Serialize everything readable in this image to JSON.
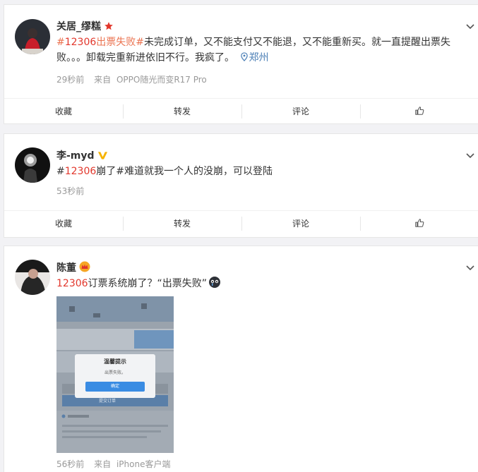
{
  "posts": [
    {
      "author": "关居_缪糕",
      "badge": "red-star-icon",
      "text": {
        "hash_open": "#",
        "num": "12306",
        "topic_rest": "出票失败#",
        "rest": "未完成订单，又不能支付又不能退，又不能重新买。就一直提醒出票失败。。。卸载完重新进依旧不行。我疯了。",
        "location": "郑州"
      },
      "time": "29秒前",
      "source_prefix": "来自",
      "source": "OPPO随光而变R17 Pro"
    },
    {
      "author": "李-myd",
      "badge": "verified-v-icon",
      "text": {
        "hash_open": "#",
        "num": "12306",
        "topic_rest": "崩了#",
        "rest": "难道就我一个人的没崩，可以登陆"
      },
      "time": "53秒前"
    },
    {
      "author": "陈董",
      "badge": "crown-icon",
      "text": {
        "num": "12306",
        "rest": "订票系统崩了？“出票失败”"
      },
      "image": {
        "dialog_title": "温馨提示",
        "dialog_message": "出票失败。",
        "dialog_button": "确定",
        "submit_label": "提交订单"
      },
      "time": "56秒前",
      "source_prefix": "来自",
      "source": "iPhone客户端"
    }
  ],
  "actions": {
    "favorite": "收藏",
    "repost": "转发",
    "comment": "评论"
  },
  "colors": {
    "topic": "#eb7350",
    "accent_red": "#e2372c",
    "location": "#4a7eb5",
    "meta": "#999999",
    "verified": "#f6b300"
  }
}
